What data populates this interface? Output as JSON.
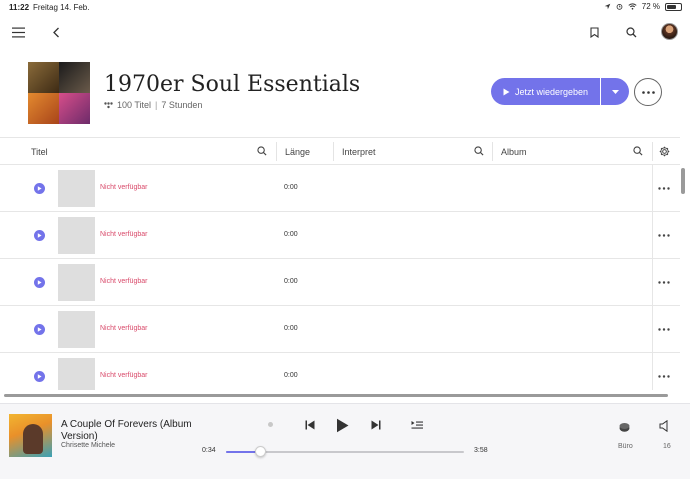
{
  "status": {
    "time": "11:22",
    "date": "Freitag 14. Feb.",
    "battery": "72 %",
    "battery_level": 0.72
  },
  "playlist": {
    "title": "1970er Soul Essentials",
    "track_count": "100 Titel",
    "duration": "7 Stunden",
    "play_label": "Jetzt wiedergeben"
  },
  "table": {
    "headers": {
      "title": "Titel",
      "length": "Länge",
      "artist": "Interpret",
      "album": "Album"
    },
    "rows": [
      {
        "status": "Nicht verfügbar",
        "duration": "0:00"
      },
      {
        "status": "Nicht verfügbar",
        "duration": "0:00"
      },
      {
        "status": "Nicht verfügbar",
        "duration": "0:00"
      },
      {
        "status": "Nicht verfügbar",
        "duration": "0:00"
      },
      {
        "status": "Nicht verfügbar",
        "duration": "0:00"
      }
    ]
  },
  "player": {
    "track_title": "A Couple Of Forevers (Album Version)",
    "artist": "Chrisette Michele",
    "elapsed": "0:34",
    "total": "3:58",
    "progress": 0.143,
    "zone": "Büro",
    "volume": "16"
  },
  "colors": {
    "accent": "#7373ea",
    "unavailable": "#d94a6a"
  }
}
